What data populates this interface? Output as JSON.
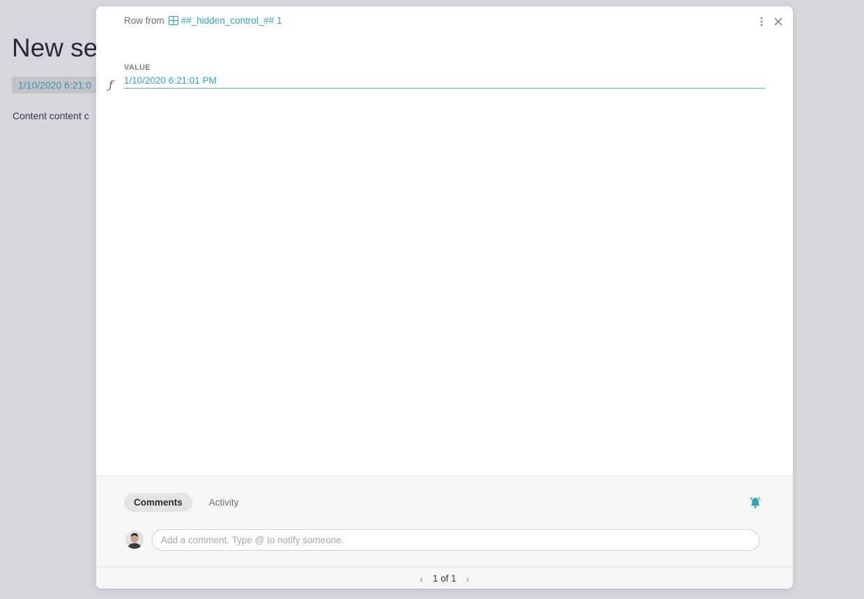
{
  "background": {
    "title": "New sec",
    "chip": "1/10/2020 6:21:0",
    "content": "Content content c"
  },
  "modal": {
    "row_from_label": "Row from",
    "table_name": "##_hidden_control_## 1",
    "table_icon": "table-grid-icon",
    "field": {
      "label": "VALUE",
      "value": "1/10/2020 6:21:01 PM",
      "type_icon": "formula-icon"
    },
    "tabs": [
      {
        "label": "Comments",
        "active": true
      },
      {
        "label": "Activity",
        "active": false
      }
    ],
    "comment_placeholder": "Add a comment. Type @ to notify someone.",
    "pager": "1 of 1"
  },
  "colors": {
    "accent": "#33a3ba",
    "background": "#d8d5dc"
  }
}
